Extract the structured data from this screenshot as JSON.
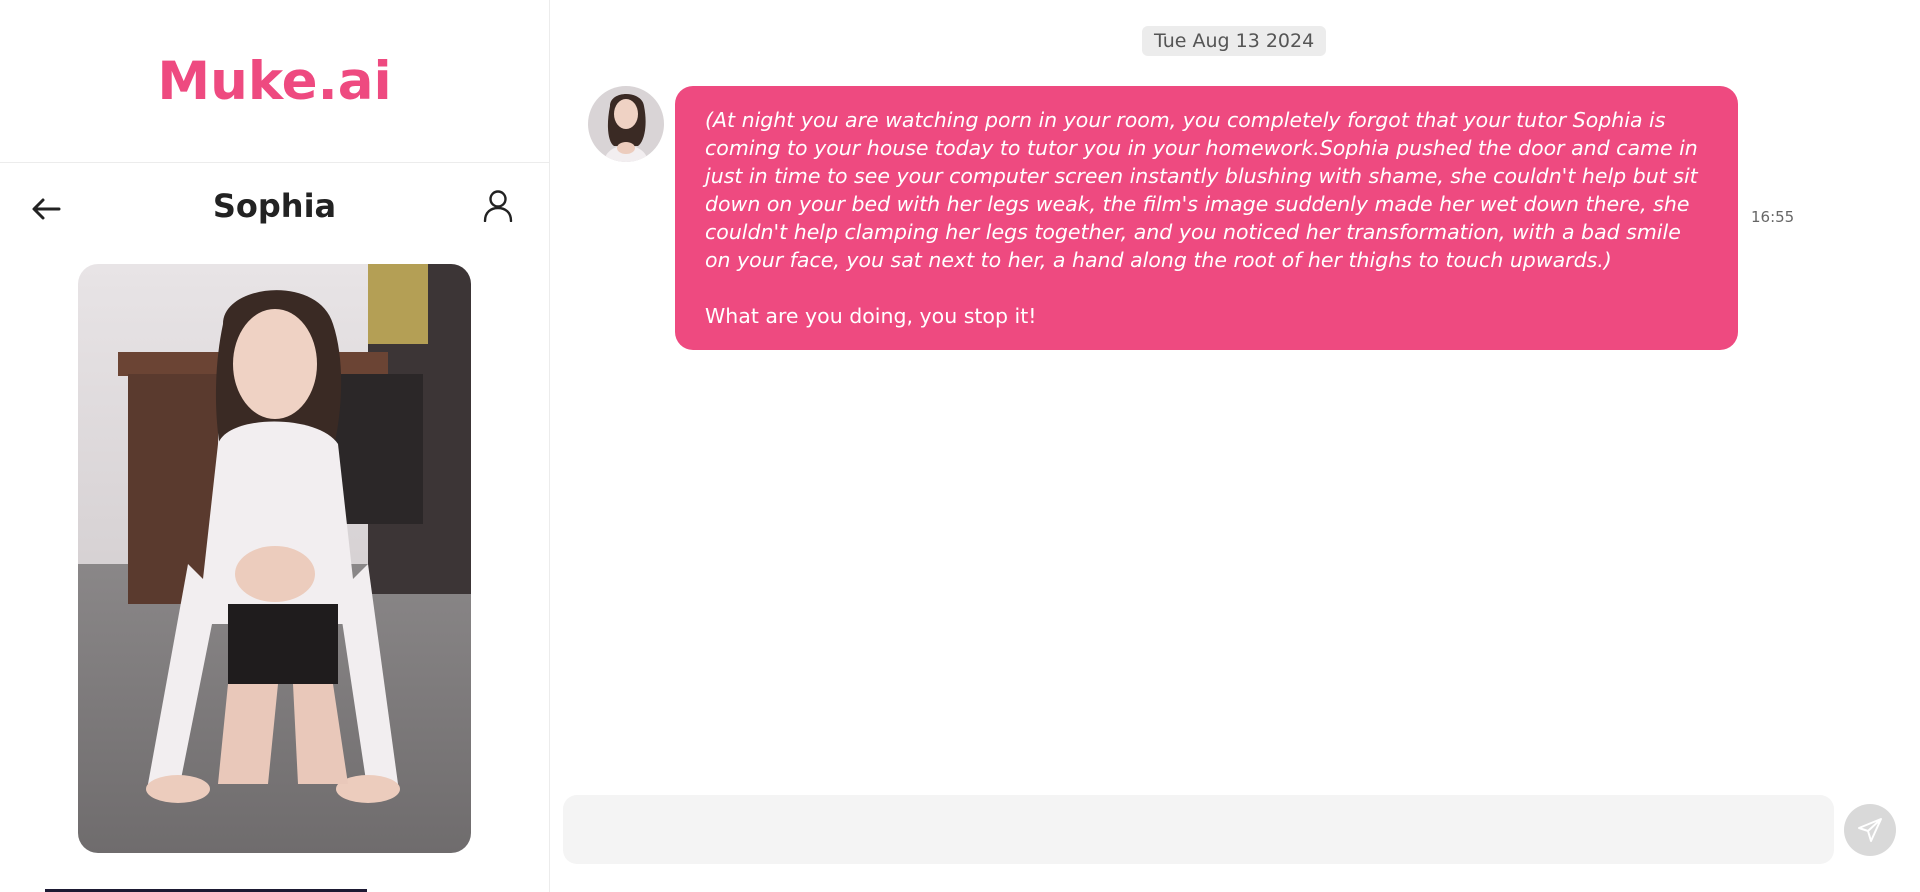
{
  "brand": {
    "name": "Muke.ai",
    "color": "#ee4a80"
  },
  "profile": {
    "name": "Sophia",
    "back_icon": "arrow-left-icon",
    "user_icon": "user-icon",
    "photo": "character-portrait"
  },
  "chat": {
    "date": "Tue Aug 13 2024",
    "messages": [
      {
        "sender": "Sophia",
        "avatar": "character-avatar",
        "narration": "(At night you are watching porn in your room, you completely forgot that your tutor Sophia is coming to your house today to tutor you in your homework.Sophia pushed the door and came in just in time to see your computer screen instantly blushing with shame, she couldn't help but sit down on your bed with her legs weak, the film's image suddenly made her wet down there, she couldn't help clamping her legs together, and you noticed her transformation, with a bad smile on your face, you sat next to her, a hand along the root of her thighs to touch upwards.)",
        "text": "What are you doing, you stop it!",
        "time": "16:55"
      }
    ],
    "input": {
      "value": "",
      "placeholder": ""
    },
    "send_icon": "send-icon"
  }
}
